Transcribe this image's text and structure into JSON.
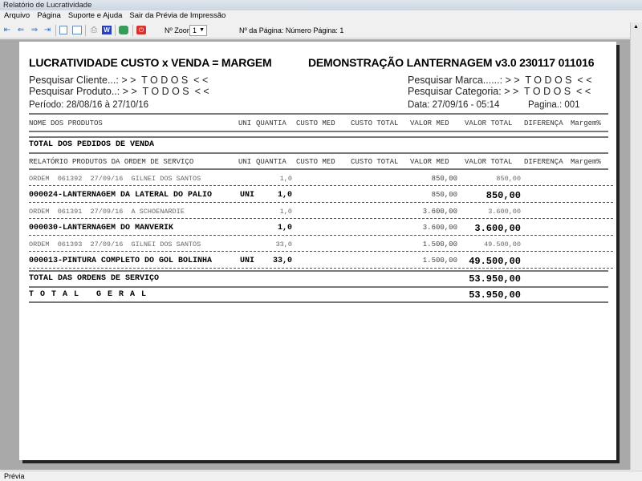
{
  "window": {
    "title": "Relatório de Lucratividade"
  },
  "menu": [
    "Arquivo",
    "Página",
    "Suporte e Ajuda",
    "Sair da Prévia de Impressão"
  ],
  "toolbar": {
    "zoom_label": "Nº Zoom",
    "zoom_value": "1",
    "page_label": "Nº da Página: Número Página: 1"
  },
  "status": "Prévia",
  "report": {
    "title": "LUCRATIVIDADE CUSTO x VENDA = MARGEM",
    "subtitle": "DEMONSTRAÇÃO LANTERNAGEM v3.0 230117 011016",
    "cliente": "Pesquisar Cliente...: > >  T O D O S  < <",
    "produto": "Pesquisar Produto..: > >  T O D O S  < <",
    "marca": "Pesquisar Marca......: > >  T O D O S  < <",
    "categoria": "Pesquisar Categoria: > >  T O D O S  < <",
    "periodo": "Período: 28/08/16 à 27/10/16",
    "data": "Data: 27/09/16 - 05:14",
    "pagina": "Pagina.: 001",
    "col_first": "NOME DOS PRODUTOS",
    "columns": [
      "UNI",
      "QUANTIA",
      "CUSTO MED",
      "CUSTO TOTAL",
      "VALOR MED",
      "VALOR TOTAL",
      "DIFERENÇA",
      "Margem%"
    ],
    "pedidos_total": "TOTAL DOS PEDIDOS DE VENDA",
    "os_header": "RELATÓRIO PRODUTOS DA ORDEM DE SERVIÇO",
    "rows": [
      {
        "desc": "ORDEM  061392  27/09/16  GILNEI DOS SANTOS",
        "uni": "",
        "qtd": "1,0",
        "vmed": "850,00",
        "vtot": "850,00"
      },
      {
        "desc": "000024-LANTERNAGEM DA LATERAL DO PALIO",
        "uni": "UNI",
        "qtd": "1,0",
        "vmed": "850,00",
        "vtot": "850,00"
      },
      {
        "desc": "ORDEM  061391  27/09/16  A SCHOENARDIE",
        "uni": "",
        "qtd": "1,0",
        "vmed": "3.600,00",
        "vtot": "3.600,00"
      },
      {
        "desc": "000030-LANTERNAGEM DO MANVERIK",
        "uni": "",
        "qtd": "1,0",
        "vmed": "3.600,00",
        "vtot": "3.600,00"
      },
      {
        "desc": "ORDEM  061393  27/09/16  GILNEI DOS SANTOS",
        "uni": "",
        "qtd": "33,0",
        "vmed": "1.500,00",
        "vtot": "49.500,00"
      },
      {
        "desc": "000013-PINTURA COMPLETO DO GOL BOLINHA",
        "uni": "UNI",
        "qtd": "33,0",
        "vmed": "1.500,00",
        "vtot": "49.500,00"
      }
    ],
    "os_total_label": "TOTAL DAS ORDENS DE SERVIÇO",
    "os_total": "53.950,00",
    "geral_label": "T O T A L   G E R A L",
    "geral": "53.950,00"
  }
}
